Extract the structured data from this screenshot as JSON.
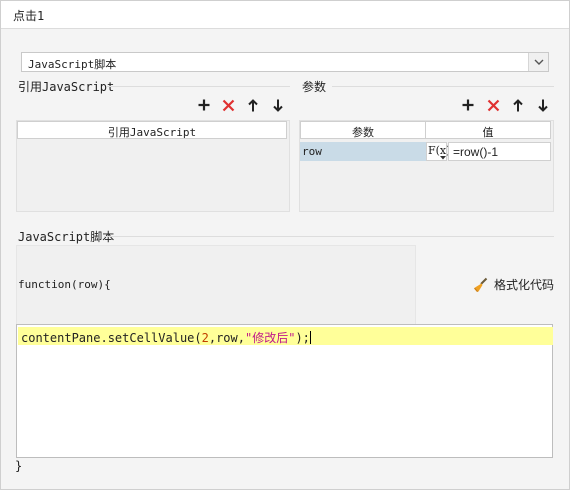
{
  "window": {
    "title": "点击1"
  },
  "script_type_select": {
    "value": "JavaScript脚本"
  },
  "ref_section": {
    "label": "引用JavaScript",
    "column_header": "引用JavaScript"
  },
  "param_section": {
    "label": "参数",
    "headers": [
      "参数",
      "值"
    ],
    "rows": [
      {
        "name": "row",
        "formula_label": "F(x)",
        "value": "=row()-1"
      }
    ]
  },
  "script_section": {
    "label": "JavaScript脚本",
    "function_header": "function(row){",
    "format_button": "格式化代码",
    "closing_brace": "}"
  },
  "editor": {
    "code_prefix": "contentPane.setCellValue(",
    "code_num": "2",
    "code_mid": ",row,",
    "code_string": "\"修改后\"",
    "code_suffix": ");"
  },
  "colors": {
    "add": "#222222",
    "delete": "#e03030",
    "highlight_line": "#ffff99",
    "selected_cell": "#c9dbe7",
    "string": "#c01a8a",
    "number": "#c04000"
  }
}
